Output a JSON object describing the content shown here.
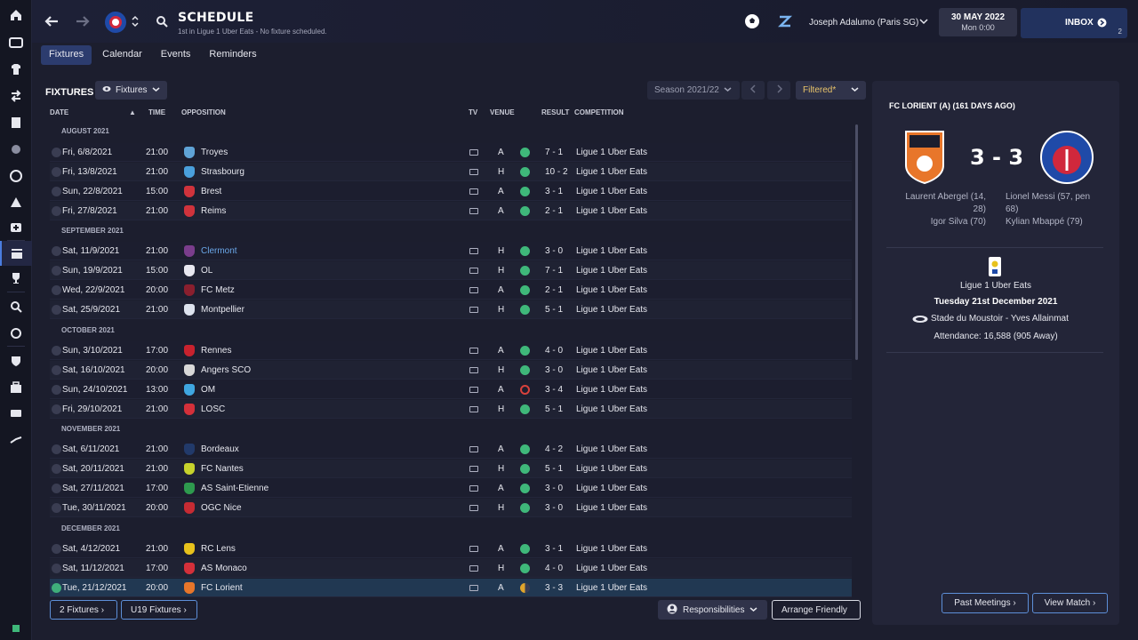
{
  "header": {
    "title": "SCHEDULE",
    "subtitle": "1st in Ligue 1 Uber Eats - No fixture scheduled.",
    "manager": "Joseph Adalumo (Paris SG)",
    "date": "30 MAY 2022",
    "time": "Mon 0:00",
    "inbox_label": "INBOX",
    "inbox_count": "2"
  },
  "tabs": [
    "Fixtures",
    "Calendar",
    "Events",
    "Reminders"
  ],
  "fixtures": {
    "title": "FIXTURES",
    "view_dropdown": "Fixtures",
    "season": "Season 2021/22",
    "filter": "Filtered*",
    "columns": {
      "date": "DATE",
      "time": "TIME",
      "opposition": "OPPOSITION",
      "tv": "TV",
      "venue": "VENUE",
      "result": "RESULT",
      "competition": "COMPETITION"
    },
    "months": [
      "AUGUST 2021",
      "SEPTEMBER 2021",
      "OCTOBER 2021",
      "NOVEMBER 2021",
      "DECEMBER 2021"
    ],
    "rows": [
      {
        "date": "Fri, 6/8/2021",
        "time": "21:00",
        "opp": "Troyes",
        "venue": "A",
        "result": "7 - 1",
        "comp": "Ligue 1 Uber Eats",
        "outcome": "win",
        "crest": "#5fa3d6"
      },
      {
        "date": "Fri, 13/8/2021",
        "time": "21:00",
        "opp": "Strasbourg",
        "venue": "H",
        "result": "10 - 2",
        "comp": "Ligue 1 Uber Eats",
        "outcome": "win",
        "crest": "#4aa0dc"
      },
      {
        "date": "Sun, 22/8/2021",
        "time": "15:00",
        "opp": "Brest",
        "venue": "A",
        "result": "3 - 1",
        "comp": "Ligue 1 Uber Eats",
        "outcome": "win",
        "crest": "#d0333c"
      },
      {
        "date": "Fri, 27/8/2021",
        "time": "21:00",
        "opp": "Reims",
        "venue": "A",
        "result": "2 - 1",
        "comp": "Ligue 1 Uber Eats",
        "outcome": "win",
        "crest": "#d0333c"
      },
      {
        "date": "Sat, 11/9/2021",
        "time": "21:00",
        "opp": "Clermont",
        "venue": "H",
        "result": "3 - 0",
        "comp": "Ligue 1 Uber Eats",
        "outcome": "win",
        "crest": "#7a3d8c",
        "link": true
      },
      {
        "date": "Sun, 19/9/2021",
        "time": "15:00",
        "opp": "OL",
        "venue": "H",
        "result": "7 - 1",
        "comp": "Ligue 1 Uber Eats",
        "outcome": "win",
        "crest": "#e8e8f0"
      },
      {
        "date": "Wed, 22/9/2021",
        "time": "20:00",
        "opp": "FC Metz",
        "venue": "A",
        "result": "2 - 1",
        "comp": "Ligue 1 Uber Eats",
        "outcome": "win",
        "crest": "#8a1f2e"
      },
      {
        "date": "Sat, 25/9/2021",
        "time": "21:00",
        "opp": "Montpellier",
        "venue": "H",
        "result": "5 - 1",
        "comp": "Ligue 1 Uber Eats",
        "outcome": "win",
        "crest": "#dde3ee"
      },
      {
        "date": "Sun, 3/10/2021",
        "time": "17:00",
        "opp": "Rennes",
        "venue": "A",
        "result": "4 - 0",
        "comp": "Ligue 1 Uber Eats",
        "outcome": "win",
        "crest": "#c8222e"
      },
      {
        "date": "Sat, 16/10/2021",
        "time": "20:00",
        "opp": "Angers SCO",
        "venue": "H",
        "result": "3 - 0",
        "comp": "Ligue 1 Uber Eats",
        "outcome": "win",
        "crest": "#d8d8d8"
      },
      {
        "date": "Sun, 24/10/2021",
        "time": "13:00",
        "opp": "OM",
        "venue": "A",
        "result": "3 - 4",
        "comp": "Ligue 1 Uber Eats",
        "outcome": "loss",
        "crest": "#3fa6e0"
      },
      {
        "date": "Fri, 29/10/2021",
        "time": "21:00",
        "opp": "LOSC",
        "venue": "H",
        "result": "5 - 1",
        "comp": "Ligue 1 Uber Eats",
        "outcome": "win",
        "crest": "#d4303a"
      },
      {
        "date": "Sat, 6/11/2021",
        "time": "21:00",
        "opp": "Bordeaux",
        "venue": "A",
        "result": "4 - 2",
        "comp": "Ligue 1 Uber Eats",
        "outcome": "win",
        "crest": "#223a6a"
      },
      {
        "date": "Sat, 20/11/2021",
        "time": "21:00",
        "opp": "FC Nantes",
        "venue": "H",
        "result": "5 - 1",
        "comp": "Ligue 1 Uber Eats",
        "outcome": "win",
        "crest": "#c7d32c"
      },
      {
        "date": "Sat, 27/11/2021",
        "time": "17:00",
        "opp": "AS Saint-Etienne",
        "venue": "A",
        "result": "3 - 0",
        "comp": "Ligue 1 Uber Eats",
        "outcome": "win",
        "crest": "#2e9a4e"
      },
      {
        "date": "Tue, 30/11/2021",
        "time": "20:00",
        "opp": "OGC Nice",
        "venue": "H",
        "result": "3 - 0",
        "comp": "Ligue 1 Uber Eats",
        "outcome": "win",
        "crest": "#c62b33"
      },
      {
        "date": "Sat, 4/12/2021",
        "time": "21:00",
        "opp": "RC Lens",
        "venue": "A",
        "result": "3 - 1",
        "comp": "Ligue 1 Uber Eats",
        "outcome": "win",
        "crest": "#e8c21c"
      },
      {
        "date": "Sat, 11/12/2021",
        "time": "17:00",
        "opp": "AS Monaco",
        "venue": "H",
        "result": "4 - 0",
        "comp": "Ligue 1 Uber Eats",
        "outcome": "win",
        "crest": "#d4303a"
      },
      {
        "date": "Tue, 21/12/2021",
        "time": "20:00",
        "opp": "FC Lorient",
        "venue": "A",
        "result": "3 - 3",
        "comp": "Ligue 1 Uber Eats",
        "outcome": "draw",
        "crest": "#e8762a",
        "selected": true
      }
    ],
    "buttons": {
      "fixtures2": "2 Fixtures",
      "u19": "U19 Fixtures",
      "responsibilities": "Responsibilities",
      "arrange": "Arrange Friendly"
    }
  },
  "match": {
    "title": "FC LORIENT (A) (161 DAYS AGO)",
    "score": "3 - 3",
    "home_scorers": [
      "Laurent Abergel (14,",
      "28)",
      "Igor Silva (70)"
    ],
    "away_scorers": [
      "Lionel Messi (57, pen",
      "68)",
      "Kylian Mbappé (79)"
    ],
    "competition": "Ligue 1 Uber Eats",
    "date": "Tuesday 21st December 2021",
    "stadium": "Stade du Moustoir - Yves Allainmat",
    "attendance": "Attendance: 16,588 (905 Away)",
    "past_meetings": "Past Meetings",
    "view_match": "View Match"
  },
  "colors": {
    "win": "#3fb87a",
    "loss": "#d8413c",
    "draw": "#e0a52c",
    "accent": "#5d8fd8",
    "home_crest": "#e8762a",
    "away_crest": "#1f4aa8"
  }
}
